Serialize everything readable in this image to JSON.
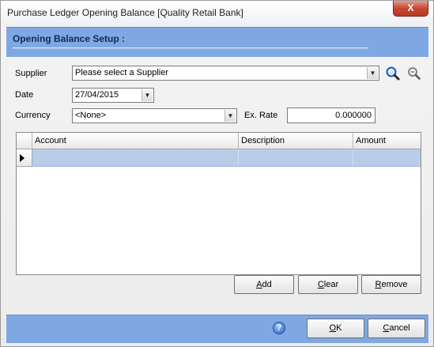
{
  "window": {
    "title": "Purchase Ledger Opening Balance  [Quality Retail Bank]",
    "close_glyph": "X"
  },
  "header": {
    "title": "Opening Balance Setup :"
  },
  "form": {
    "supplier": {
      "label": "Supplier",
      "value": "Please select a Supplier"
    },
    "date": {
      "label": "Date",
      "value": "27/04/2015"
    },
    "currency": {
      "label": "Currency",
      "value": "<None>"
    },
    "ex_rate": {
      "label": "Ex. Rate",
      "value": "0.000000"
    }
  },
  "icons": {
    "search": "search-icon",
    "zoom": "zoom-icon",
    "help": "help-icon"
  },
  "grid": {
    "columns": [
      "Account",
      "Description",
      "Amount"
    ],
    "rows": [
      {
        "account": "",
        "description": "",
        "amount": ""
      }
    ]
  },
  "grid_buttons": {
    "add": {
      "prefix": "",
      "accel": "A",
      "rest": "dd"
    },
    "clear": {
      "prefix": "",
      "accel": "C",
      "rest": "lear"
    },
    "remove": {
      "prefix": "",
      "accel": "R",
      "rest": "emove"
    }
  },
  "footer": {
    "help_glyph": "?",
    "ok": {
      "prefix": "",
      "accel": "O",
      "rest": "K"
    },
    "cancel": {
      "prefix": "",
      "accel": "C",
      "rest": "ancel"
    }
  },
  "colors": {
    "accent_band": "#7fa8e3",
    "selected_row": "#b9cde9",
    "close_button": "#c7472f"
  }
}
